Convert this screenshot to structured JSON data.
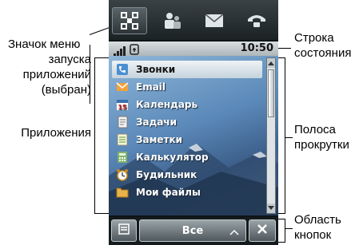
{
  "callouts": {
    "menu_icon_line1": "Значок меню",
    "menu_icon_line2": "запуска",
    "menu_icon_line3": "приложений",
    "menu_icon_line4": "(выбран)",
    "applications": "Приложения",
    "status_bar_line1": "Строка",
    "status_bar_line2": "состояния",
    "scrollbar_line1": "Полоса",
    "scrollbar_line2": "прокрутки",
    "button_area_line1": "Область",
    "button_area_line2": "кнопок"
  },
  "status_bar": {
    "time": "10:50"
  },
  "top_icons": [
    {
      "name": "app-launcher-icon",
      "selected": true
    },
    {
      "name": "contacts-icon",
      "selected": false
    },
    {
      "name": "message-icon",
      "selected": false
    },
    {
      "name": "phone-icon",
      "selected": false
    }
  ],
  "apps": [
    {
      "label": "Звонки",
      "icon": "calls-icon"
    },
    {
      "label": "Email",
      "icon": "email-icon"
    },
    {
      "label": "Календарь",
      "icon": "calendar-icon"
    },
    {
      "label": "Задачи",
      "icon": "tasks-icon"
    },
    {
      "label": "Заметки",
      "icon": "notes-icon"
    },
    {
      "label": "Калькулятор",
      "icon": "calculator-icon"
    },
    {
      "label": "Будильник",
      "icon": "alarm-icon"
    },
    {
      "label": "Мои файлы",
      "icon": "folder-icon"
    }
  ],
  "button_bar": {
    "center_label": "Все"
  }
}
